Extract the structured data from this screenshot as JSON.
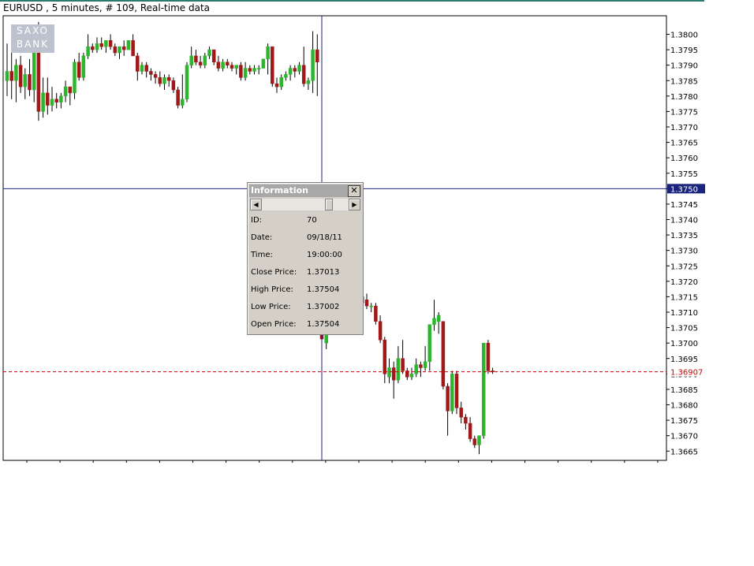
{
  "window": {
    "title": "EURUSD , 5 minutes, # 109, Real-time data"
  },
  "logo": {
    "line1": "SAXO",
    "line2": "BANK"
  },
  "info_panel": {
    "title": "Information",
    "close_label": "✕",
    "rows": [
      {
        "label": "ID:",
        "value": "70"
      },
      {
        "label": "Date:",
        "value": "09/18/11"
      },
      {
        "label": "Time:",
        "value": "19:00:00"
      },
      {
        "label": "Close Price:",
        "value": "1.37013"
      },
      {
        "label": "High Price:",
        "value": "1.37504"
      },
      {
        "label": "Low Price:",
        "value": "1.37002"
      },
      {
        "label": "Open Price:",
        "value": "1.37504"
      }
    ]
  },
  "colors": {
    "bull": "#2db52d",
    "bear": "#a01818",
    "crosshair": "#1a237e",
    "current_price_line": "#cc0000",
    "axis": "#000000"
  },
  "chart_data": {
    "type": "candlestick",
    "symbol": "EURUSD",
    "interval": "5 minutes",
    "ylim": [
      1.3662,
      1.3806
    ],
    "y_ticks": [
      "1.3800",
      "1.3795",
      "1.3790",
      "1.3785",
      "1.3780",
      "1.3775",
      "1.3770",
      "1.3765",
      "1.3760",
      "1.3755",
      "1.3750",
      "1.3745",
      "1.3740",
      "1.3735",
      "1.3730",
      "1.3725",
      "1.3720",
      "1.3715",
      "1.3710",
      "1.3705",
      "1.3700",
      "1.3695",
      "1.3690",
      "1.3685",
      "1.3680",
      "1.3675",
      "1.3670",
      "1.3665"
    ],
    "crosshair_price": "1.3750",
    "current_price": "1.36907",
    "crosshair_index": 70,
    "grid": false,
    "candles": [
      {
        "o": 1.3785,
        "h": 1.3797,
        "l": 1.378,
        "c": 1.3788
      },
      {
        "o": 1.3788,
        "h": 1.3794,
        "l": 1.3779,
        "c": 1.3785
      },
      {
        "o": 1.3785,
        "h": 1.3792,
        "l": 1.3778,
        "c": 1.379
      },
      {
        "o": 1.379,
        "h": 1.3793,
        "l": 1.3781,
        "c": 1.3783
      },
      {
        "o": 1.3783,
        "h": 1.3789,
        "l": 1.3779,
        "c": 1.3787
      },
      {
        "o": 1.3787,
        "h": 1.3792,
        "l": 1.378,
        "c": 1.3782
      },
      {
        "o": 1.3782,
        "h": 1.38,
        "l": 1.3778,
        "c": 1.3799
      },
      {
        "o": 1.3799,
        "h": 1.3804,
        "l": 1.3772,
        "c": 1.3775
      },
      {
        "o": 1.3775,
        "h": 1.3786,
        "l": 1.3773,
        "c": 1.3781
      },
      {
        "o": 1.3781,
        "h": 1.3786,
        "l": 1.3774,
        "c": 1.3777
      },
      {
        "o": 1.3777,
        "h": 1.3783,
        "l": 1.3775,
        "c": 1.3779
      },
      {
        "o": 1.3779,
        "h": 1.3781,
        "l": 1.3776,
        "c": 1.3778
      },
      {
        "o": 1.3778,
        "h": 1.3781,
        "l": 1.3776,
        "c": 1.378
      },
      {
        "o": 1.378,
        "h": 1.3785,
        "l": 1.3778,
        "c": 1.3783
      },
      {
        "o": 1.3783,
        "h": 1.3783,
        "l": 1.3777,
        "c": 1.3781
      },
      {
        "o": 1.3781,
        "h": 1.3792,
        "l": 1.3779,
        "c": 1.3791
      },
      {
        "o": 1.3791,
        "h": 1.3794,
        "l": 1.3785,
        "c": 1.3786
      },
      {
        "o": 1.3786,
        "h": 1.3794,
        "l": 1.3785,
        "c": 1.3793
      },
      {
        "o": 1.3793,
        "h": 1.38,
        "l": 1.3792,
        "c": 1.3796
      },
      {
        "o": 1.3796,
        "h": 1.3797,
        "l": 1.3794,
        "c": 1.3795
      },
      {
        "o": 1.3795,
        "h": 1.3799,
        "l": 1.3794,
        "c": 1.3797
      },
      {
        "o": 1.3797,
        "h": 1.3799,
        "l": 1.3795,
        "c": 1.3796
      },
      {
        "o": 1.3796,
        "h": 1.3798,
        "l": 1.3794,
        "c": 1.3798
      },
      {
        "o": 1.3798,
        "h": 1.38,
        "l": 1.3795,
        "c": 1.3796
      },
      {
        "o": 1.3796,
        "h": 1.3797,
        "l": 1.3793,
        "c": 1.3794
      },
      {
        "o": 1.3794,
        "h": 1.3796,
        "l": 1.3792,
        "c": 1.3796
      },
      {
        "o": 1.3796,
        "h": 1.3798,
        "l": 1.3793,
        "c": 1.3795
      },
      {
        "o": 1.3795,
        "h": 1.3798,
        "l": 1.3795,
        "c": 1.3798
      },
      {
        "o": 1.3798,
        "h": 1.38,
        "l": 1.3793,
        "c": 1.3793
      },
      {
        "o": 1.3793,
        "h": 1.3794,
        "l": 1.3785,
        "c": 1.3788
      },
      {
        "o": 1.3788,
        "h": 1.3791,
        "l": 1.3787,
        "c": 1.379
      },
      {
        "o": 1.379,
        "h": 1.3791,
        "l": 1.3786,
        "c": 1.3788
      },
      {
        "o": 1.3788,
        "h": 1.3789,
        "l": 1.3785,
        "c": 1.3787
      },
      {
        "o": 1.3787,
        "h": 1.3788,
        "l": 1.3784,
        "c": 1.3786
      },
      {
        "o": 1.3786,
        "h": 1.3788,
        "l": 1.3783,
        "c": 1.3784
      },
      {
        "o": 1.3784,
        "h": 1.3787,
        "l": 1.3782,
        "c": 1.3786
      },
      {
        "o": 1.3786,
        "h": 1.3787,
        "l": 1.3783,
        "c": 1.3785
      },
      {
        "o": 1.3785,
        "h": 1.3786,
        "l": 1.3781,
        "c": 1.3782
      },
      {
        "o": 1.3782,
        "h": 1.3783,
        "l": 1.3776,
        "c": 1.3777
      },
      {
        "o": 1.3777,
        "h": 1.3787,
        "l": 1.3776,
        "c": 1.3779
      },
      {
        "o": 1.3779,
        "h": 1.3791,
        "l": 1.3778,
        "c": 1.379
      },
      {
        "o": 1.379,
        "h": 1.3796,
        "l": 1.3789,
        "c": 1.3793
      },
      {
        "o": 1.3793,
        "h": 1.3795,
        "l": 1.379,
        "c": 1.3791
      },
      {
        "o": 1.3791,
        "h": 1.3793,
        "l": 1.3789,
        "c": 1.379
      },
      {
        "o": 1.379,
        "h": 1.3794,
        "l": 1.3789,
        "c": 1.3793
      },
      {
        "o": 1.3793,
        "h": 1.3796,
        "l": 1.3792,
        "c": 1.3795
      },
      {
        "o": 1.3795,
        "h": 1.3795,
        "l": 1.379,
        "c": 1.3791
      },
      {
        "o": 1.3791,
        "h": 1.3793,
        "l": 1.3788,
        "c": 1.3789
      },
      {
        "o": 1.3789,
        "h": 1.3792,
        "l": 1.3788,
        "c": 1.3791
      },
      {
        "o": 1.3791,
        "h": 1.3792,
        "l": 1.3789,
        "c": 1.379
      },
      {
        "o": 1.379,
        "h": 1.3791,
        "l": 1.3788,
        "c": 1.3789
      },
      {
        "o": 1.3789,
        "h": 1.379,
        "l": 1.3787,
        "c": 1.379
      },
      {
        "o": 1.379,
        "h": 1.3791,
        "l": 1.3785,
        "c": 1.3786
      },
      {
        "o": 1.3786,
        "h": 1.3791,
        "l": 1.3785,
        "c": 1.3789
      },
      {
        "o": 1.3789,
        "h": 1.379,
        "l": 1.3787,
        "c": 1.3788
      },
      {
        "o": 1.3788,
        "h": 1.379,
        "l": 1.3787,
        "c": 1.3789
      },
      {
        "o": 1.3789,
        "h": 1.379,
        "l": 1.3787,
        "c": 1.3789
      },
      {
        "o": 1.3789,
        "h": 1.3792,
        "l": 1.3789,
        "c": 1.3792
      },
      {
        "o": 1.3792,
        "h": 1.3797,
        "l": 1.3787,
        "c": 1.3796
      },
      {
        "o": 1.3796,
        "h": 1.3796,
        "l": 1.3783,
        "c": 1.3784
      },
      {
        "o": 1.3784,
        "h": 1.3786,
        "l": 1.3781,
        "c": 1.3783
      },
      {
        "o": 1.3783,
        "h": 1.3787,
        "l": 1.3782,
        "c": 1.3786
      },
      {
        "o": 1.3786,
        "h": 1.3788,
        "l": 1.3785,
        "c": 1.3787
      },
      {
        "o": 1.3787,
        "h": 1.379,
        "l": 1.3785,
        "c": 1.3789
      },
      {
        "o": 1.3789,
        "h": 1.379,
        "l": 1.3786,
        "c": 1.3788
      },
      {
        "o": 1.3788,
        "h": 1.3791,
        "l": 1.3787,
        "c": 1.379
      },
      {
        "o": 1.379,
        "h": 1.3796,
        "l": 1.3783,
        "c": 1.3784
      },
      {
        "o": 1.3784,
        "h": 1.3786,
        "l": 1.3782,
        "c": 1.3785
      },
      {
        "o": 1.3785,
        "h": 1.3801,
        "l": 1.3781,
        "c": 1.3795
      },
      {
        "o": 1.3795,
        "h": 1.38,
        "l": 1.378,
        "c": 1.3791
      },
      {
        "o": 1.37504,
        "h": 1.37504,
        "l": 1.37002,
        "c": 1.37013
      },
      {
        "o": 1.37,
        "h": 1.372,
        "l": 1.3698,
        "c": 1.3717
      },
      {
        "o": 1.3716,
        "h": 1.373,
        "l": 1.371,
        "c": 1.3718
      },
      {
        "o": 1.3716,
        "h": 1.3724,
        "l": 1.3711,
        "c": 1.3722
      },
      {
        "o": 1.3722,
        "h": 1.3729,
        "l": 1.3718,
        "c": 1.3723
      },
      {
        "o": 1.3722,
        "h": 1.3724,
        "l": 1.3712,
        "c": 1.3715
      },
      {
        "o": 1.3715,
        "h": 1.3716,
        "l": 1.3711,
        "c": 1.3712
      },
      {
        "o": 1.3712,
        "h": 1.3716,
        "l": 1.3705,
        "c": 1.3713
      },
      {
        "o": 1.3713,
        "h": 1.3716,
        "l": 1.3712,
        "c": 1.3715
      },
      {
        "o": 1.3715,
        "h": 1.3716,
        "l": 1.3712,
        "c": 1.3713
      },
      {
        "o": 1.3714,
        "h": 1.3716,
        "l": 1.3711,
        "c": 1.3712
      },
      {
        "o": 1.3712,
        "h": 1.3713,
        "l": 1.371,
        "c": 1.3712
      },
      {
        "o": 1.3712,
        "h": 1.3713,
        "l": 1.3706,
        "c": 1.3707
      },
      {
        "o": 1.3707,
        "h": 1.3709,
        "l": 1.37,
        "c": 1.3701
      },
      {
        "o": 1.3701,
        "h": 1.3702,
        "l": 1.3687,
        "c": 1.369
      },
      {
        "o": 1.3689,
        "h": 1.3695,
        "l": 1.3687,
        "c": 1.3692
      },
      {
        "o": 1.3692,
        "h": 1.3694,
        "l": 1.3682,
        "c": 1.3688
      },
      {
        "o": 1.3688,
        "h": 1.3699,
        "l": 1.3687,
        "c": 1.3695
      },
      {
        "o": 1.3695,
        "h": 1.3701,
        "l": 1.369,
        "c": 1.3691
      },
      {
        "o": 1.3691,
        "h": 1.3692,
        "l": 1.3688,
        "c": 1.3689
      },
      {
        "o": 1.3689,
        "h": 1.3692,
        "l": 1.3688,
        "c": 1.369
      },
      {
        "o": 1.369,
        "h": 1.3695,
        "l": 1.3689,
        "c": 1.3693
      },
      {
        "o": 1.3693,
        "h": 1.3694,
        "l": 1.3689,
        "c": 1.3692
      },
      {
        "o": 1.3692,
        "h": 1.3699,
        "l": 1.3691,
        "c": 1.3694
      },
      {
        "o": 1.3694,
        "h": 1.3705,
        "l": 1.3691,
        "c": 1.3706
      },
      {
        "o": 1.3706,
        "h": 1.3714,
        "l": 1.3704,
        "c": 1.3708
      },
      {
        "o": 1.3707,
        "h": 1.371,
        "l": 1.3703,
        "c": 1.3709
      },
      {
        "o": 1.3707,
        "h": 1.3706,
        "l": 1.3685,
        "c": 1.3686
      },
      {
        "o": 1.3686,
        "h": 1.3687,
        "l": 1.367,
        "c": 1.3678
      },
      {
        "o": 1.3678,
        "h": 1.3691,
        "l": 1.3677,
        "c": 1.369
      },
      {
        "o": 1.369,
        "h": 1.3691,
        "l": 1.3677,
        "c": 1.3679
      },
      {
        "o": 1.3679,
        "h": 1.3681,
        "l": 1.3674,
        "c": 1.3676
      },
      {
        "o": 1.3676,
        "h": 1.3677,
        "l": 1.3672,
        "c": 1.3674
      },
      {
        "o": 1.3674,
        "h": 1.3676,
        "l": 1.3668,
        "c": 1.3669
      },
      {
        "o": 1.3669,
        "h": 1.367,
        "l": 1.3666,
        "c": 1.3667
      },
      {
        "o": 1.3667,
        "h": 1.367,
        "l": 1.3664,
        "c": 1.367
      },
      {
        "o": 1.367,
        "h": 1.37,
        "l": 1.3669,
        "c": 1.37
      },
      {
        "o": 1.37,
        "h": 1.3701,
        "l": 1.369,
        "c": 1.3691
      },
      {
        "o": 1.3691,
        "h": 1.3692,
        "l": 1.369,
        "c": 1.36907
      }
    ]
  }
}
